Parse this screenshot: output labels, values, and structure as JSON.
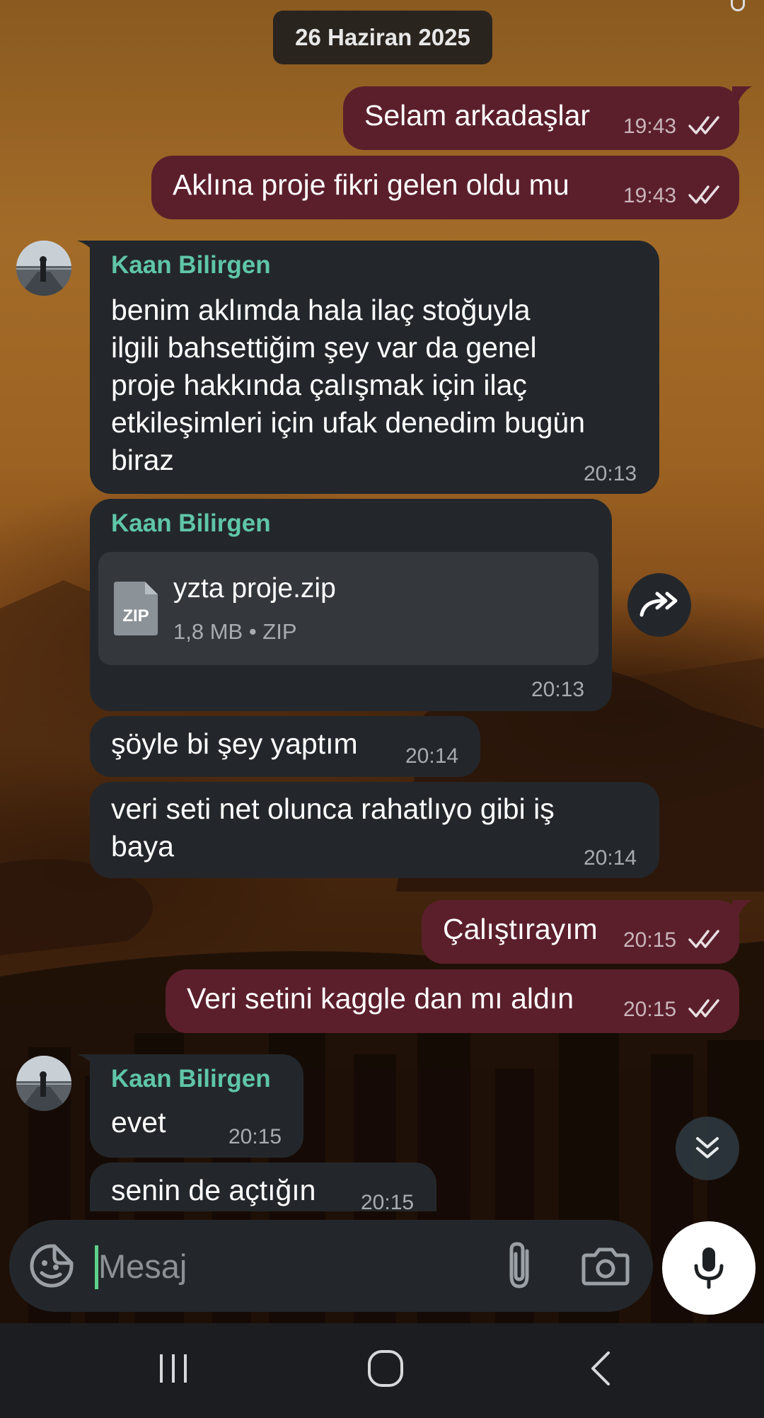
{
  "date_separator": "26 Haziran 2025",
  "messages": [
    {
      "direction": "out",
      "text": "Selam arkadaşlar",
      "time": "19:43",
      "status": "read"
    },
    {
      "direction": "out",
      "text": "Aklına proje fikri gelen oldu mu",
      "time": "19:43",
      "status": "read"
    },
    {
      "direction": "in",
      "sender": "Kaan Bilirgen",
      "lines": [
        "benim aklımda hala ilaç stoğuyla",
        "ilgili bahsettiğim şey var da genel",
        "proje hakkında çalışmak için ilaç",
        "etkileşimleri için ufak denedim bugün",
        "biraz"
      ],
      "time": "20:13"
    },
    {
      "direction": "in",
      "sender": "Kaan Bilirgen",
      "file": {
        "badge": "ZIP",
        "name": "yzta proje.zip",
        "meta": "1,8 MB • ZIP"
      },
      "time": "20:13"
    },
    {
      "direction": "in",
      "text": "şöyle bi şey yaptım",
      "time": "20:14"
    },
    {
      "direction": "in",
      "lines": [
        "veri seti net olunca rahatlıyo gibi iş",
        "baya"
      ],
      "time": "20:14"
    },
    {
      "direction": "out",
      "text": "Çalıştırayım",
      "time": "20:15",
      "status": "read"
    },
    {
      "direction": "out",
      "text": "Veri setini kaggle dan mı aldın",
      "time": "20:15",
      "status": "read"
    },
    {
      "direction": "in",
      "sender": "Kaan Bilirgen",
      "text": "evet",
      "time": "20:15"
    },
    {
      "direction": "in",
      "text": "senin de açtığın",
      "time": "20:15"
    }
  ],
  "composer": {
    "placeholder": "Mesaj"
  },
  "icons": {
    "emoji": "sticker-emoji-icon",
    "attach": "paperclip-icon",
    "camera": "camera-icon",
    "mic": "microphone-icon",
    "forward": "forward-icon",
    "scroll_down": "double-chevron-down-icon",
    "read": "double-check-icon"
  },
  "colors": {
    "outgoing_bubble": "#5b1f2b",
    "incoming_bubble": "#23272b",
    "sender_name": "#5fc6a8",
    "cursor": "#5fd08a"
  }
}
